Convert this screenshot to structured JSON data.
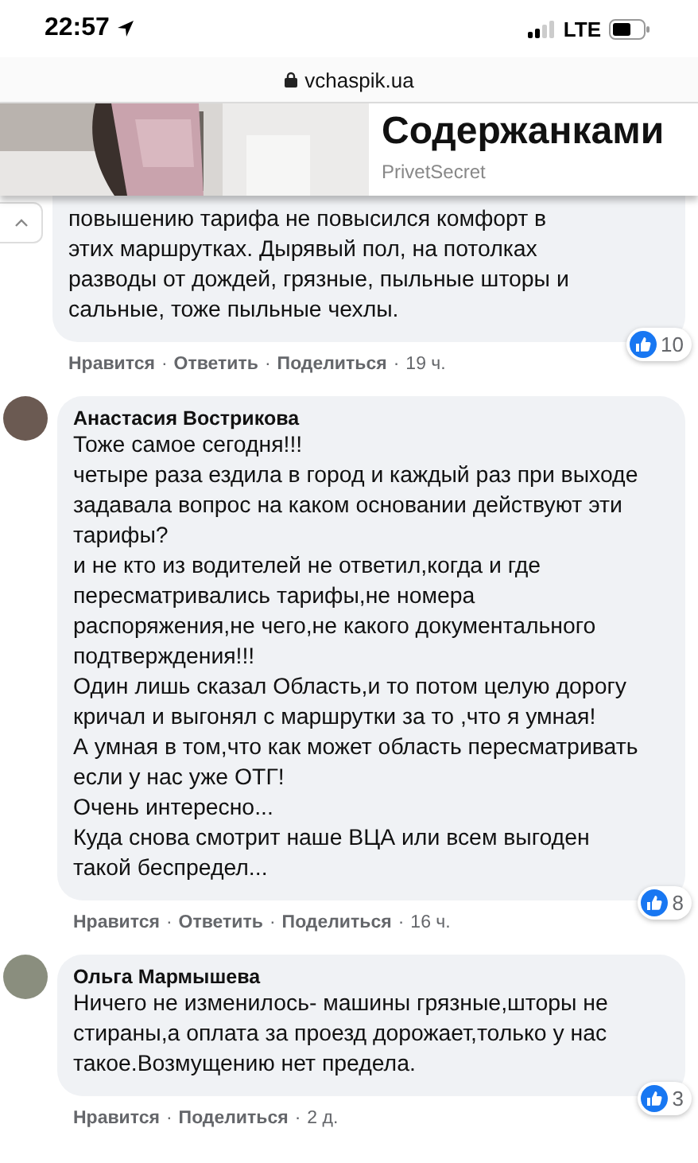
{
  "status_bar": {
    "time": "22:57",
    "network": "LTE"
  },
  "address_bar": {
    "url": "vchaspik.ua"
  },
  "ad": {
    "title": "Содержанками",
    "source": "PrivetSecret"
  },
  "comments": [
    {
      "text": "повышению тарифа не повысился комфорт в\nэтих маршрутках. Дырявый пол, на потолках\nразводы от дождей, грязные, пыльные шторы и\nсальные, тоже пыльные чехлы.",
      "reactions": "10",
      "actions": [
        {
          "kind": "link",
          "text": "Нравится"
        },
        {
          "kind": "dot",
          "text": "·"
        },
        {
          "kind": "link",
          "text": "Ответить"
        },
        {
          "kind": "dot",
          "text": "·"
        },
        {
          "kind": "link",
          "text": "Поделиться"
        },
        {
          "kind": "dot",
          "text": "·"
        },
        {
          "kind": "time",
          "text": "19 ч."
        }
      ]
    },
    {
      "author": "Анастасия Вострикова",
      "text": "Тоже самое сегодня!!!\nчетыре раза ездила в город и каждый раз при выходе\nзадавала вопрос на каком основании действуют эти\nтарифы?\nи не кто из водителей не ответил,когда и где\nпересматривались тарифы,не номера\nраспоряжения,не чего,не какого документального\nподтверждения!!!\nОдин лишь сказал Область,и то потом целую дорогу\nкричал и выгонял с маршрутки за то ,что я умная!\nА умная в том,что как может область пересматривать\nесли у нас уже ОТГ!\nОчень интересно...\nКуда снова смотрит наше ВЦА или всем выгоден\nтакой беспредел...",
      "reactions": "8",
      "actions": [
        {
          "kind": "link",
          "text": "Нравится"
        },
        {
          "kind": "dot",
          "text": "·"
        },
        {
          "kind": "link",
          "text": "Ответить"
        },
        {
          "kind": "dot",
          "text": "·"
        },
        {
          "kind": "link",
          "text": "Поделиться"
        },
        {
          "kind": "dot",
          "text": "·"
        },
        {
          "kind": "time",
          "text": "16 ч."
        }
      ]
    },
    {
      "author": "Ольга Мармышева",
      "text": "Ничего не изменилось- машины грязные,шторы не\nстираны,а оплата за проезд дорожает,только у нас\nтакое.Возмущению нет предела.",
      "reactions": "3",
      "actions": [
        {
          "kind": "link",
          "text": "Нравится"
        },
        {
          "kind": "dot",
          "text": "·"
        },
        {
          "kind": "link",
          "text": "Поделиться"
        },
        {
          "kind": "dot",
          "text": "·"
        },
        {
          "kind": "time",
          "text": "2 д."
        }
      ]
    }
  ]
}
